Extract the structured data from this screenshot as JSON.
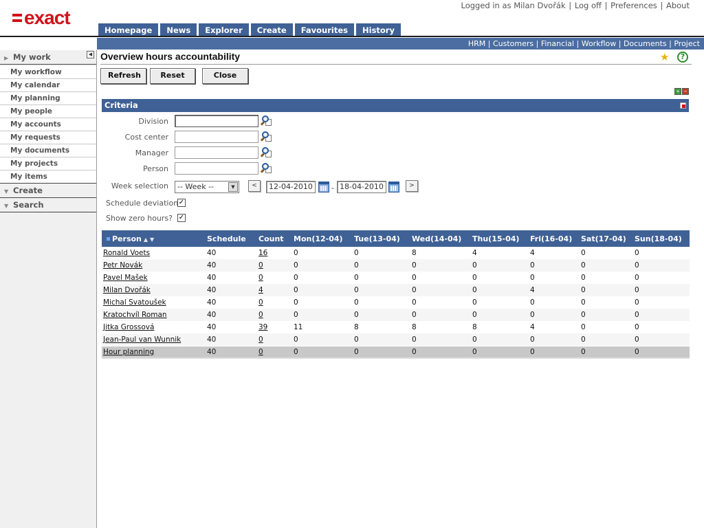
{
  "brand": {
    "logo_text": "exact"
  },
  "user_links": {
    "logged_in": "Logged in as Milan Dvořák",
    "logoff": "Log off",
    "preferences": "Preferences",
    "about": "About"
  },
  "main_nav": [
    "Homepage",
    "News",
    "Explorer",
    "Create",
    "Favourites",
    "History"
  ],
  "sub_nav": [
    "HRM",
    "Customers",
    "Financial",
    "Workflow",
    "Documents",
    "Project"
  ],
  "sidebar": {
    "my_work": "My work",
    "items": [
      "My workflow",
      "My calendar",
      "My planning",
      "My people",
      "My accounts",
      "My requests",
      "My documents",
      "My projects",
      "My items"
    ],
    "create": "Create",
    "search": "Search"
  },
  "page": {
    "title": "Overview hours accountability"
  },
  "toolbar": {
    "refresh": "Refresh",
    "reset": "Reset",
    "close": "Close"
  },
  "criteria": {
    "title": "Criteria",
    "division_label": "Division",
    "division_value": "",
    "cost_center_label": "Cost center",
    "cost_center_value": "",
    "manager_label": "Manager",
    "manager_value": "",
    "person_label": "Person",
    "person_value": "",
    "week_label": "Week selection",
    "week_value": "-- Week --",
    "prev": "<",
    "next": ">",
    "date_from": "12-04-2010",
    "date_sep": "-",
    "date_to": "18-04-2010",
    "schedule_deviation_label": "Schedule deviation",
    "schedule_deviation_checked": "✓",
    "show_zero_label": "Show zero hours?",
    "show_zero_checked": "✓"
  },
  "table": {
    "headers": [
      "Person",
      "Schedule",
      "Count",
      "Mon(12-04)",
      "Tue(13-04)",
      "Wed(14-04)",
      "Thu(15-04)",
      "Fri(16-04)",
      "Sat(17-04)",
      "Sun(18-04)"
    ],
    "rows": [
      [
        "Ronald Voets",
        "40",
        "16",
        "0",
        "0",
        "8",
        "4",
        "4",
        "0",
        "0"
      ],
      [
        "Petr Novák",
        "40",
        "0",
        "0",
        "0",
        "0",
        "0",
        "0",
        "0",
        "0"
      ],
      [
        "Pavel Mašek",
        "40",
        "0",
        "0",
        "0",
        "0",
        "0",
        "0",
        "0",
        "0"
      ],
      [
        "Milan Dvořák",
        "40",
        "4",
        "0",
        "0",
        "0",
        "0",
        "4",
        "0",
        "0"
      ],
      [
        "Michal Svatoušek",
        "40",
        "0",
        "0",
        "0",
        "0",
        "0",
        "0",
        "0",
        "0"
      ],
      [
        "Kratochvíl Roman",
        "40",
        "0",
        "0",
        "0",
        "0",
        "0",
        "0",
        "0",
        "0"
      ],
      [
        "Jitka Grossová",
        "40",
        "39",
        "11",
        "8",
        "8",
        "8",
        "4",
        "0",
        "0"
      ],
      [
        "Jean-Paul van Wunnik",
        "40",
        "0",
        "0",
        "0",
        "0",
        "0",
        "0",
        "0",
        "0"
      ]
    ],
    "total": [
      "Hour planning",
      "40",
      "0",
      "0",
      "0",
      "0",
      "0",
      "0",
      "0",
      "0"
    ]
  }
}
